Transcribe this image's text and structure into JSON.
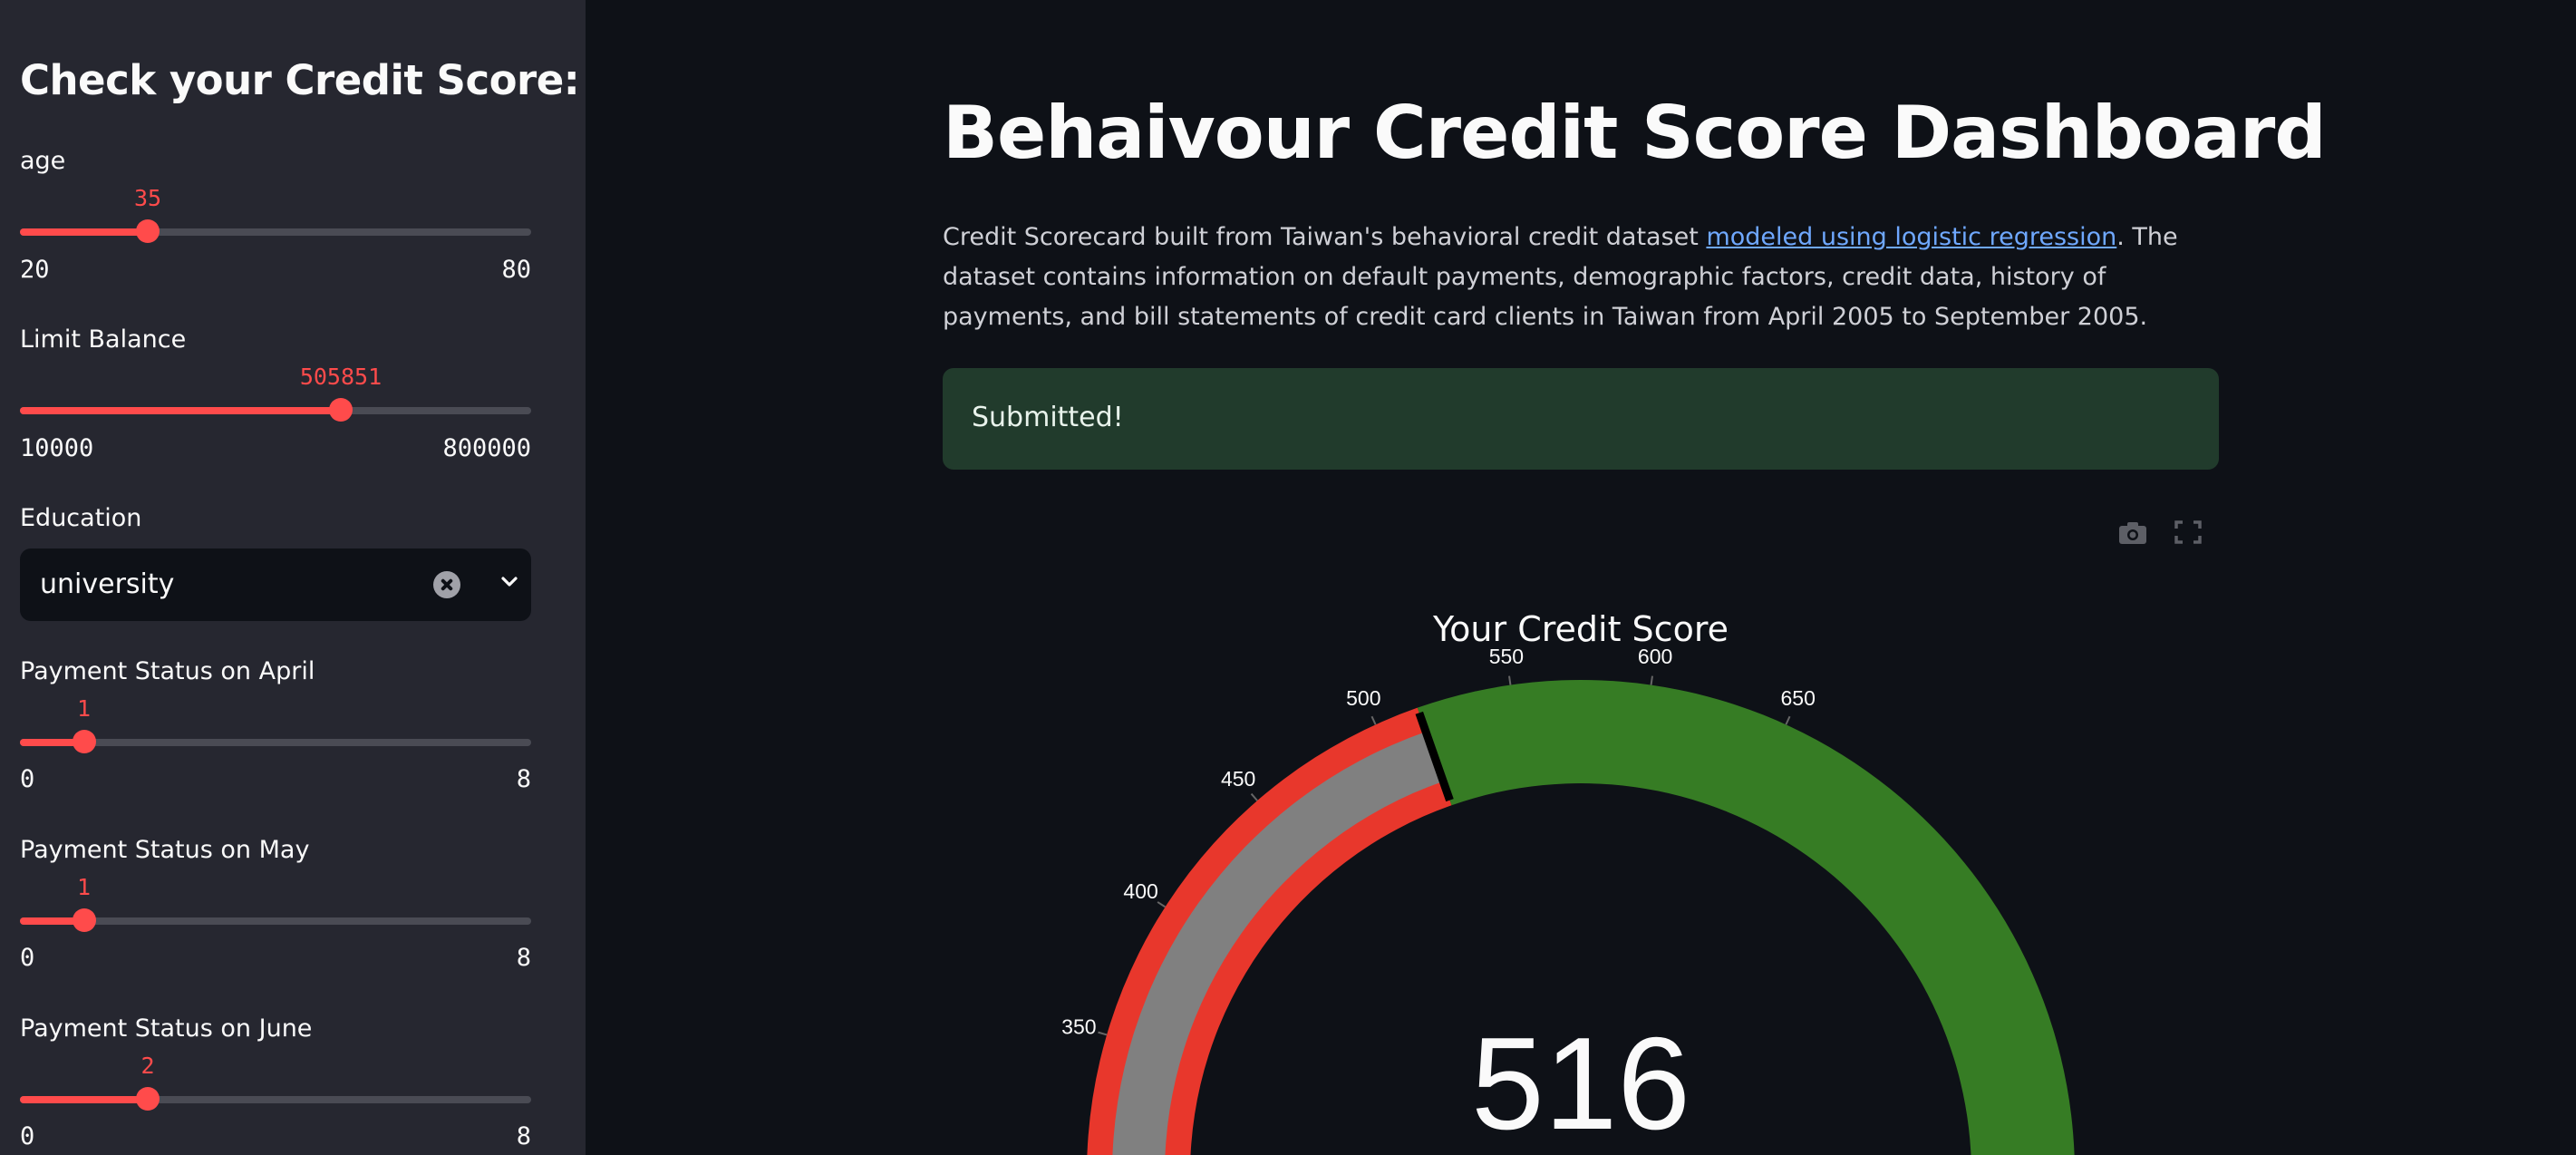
{
  "sidebar": {
    "title": "Check your Credit Score:",
    "age": {
      "label": "age",
      "value": 35,
      "min": 20,
      "max": 80
    },
    "limit_balance": {
      "label": "Limit Balance",
      "value": 505851,
      "min": 10000,
      "max": 800000
    },
    "education": {
      "label": "Education",
      "value": "university"
    },
    "pay_april": {
      "label": "Payment Status on April",
      "value": 1,
      "min": 0,
      "max": 8
    },
    "pay_may": {
      "label": "Payment Status on May",
      "value": 1,
      "min": 0,
      "max": 8
    },
    "pay_june": {
      "label": "Payment Status on June",
      "value": 2,
      "min": 0,
      "max": 8
    }
  },
  "main": {
    "title": "Behaivour Credit Score Dashboard",
    "description_pre": "Credit Scorecard built from Taiwan's behavioral credit dataset ",
    "description_link": "modeled using logistic regression",
    "description_post": ". The dataset contains information on default payments, demographic factors, credit data, history of payments, and bill statements of credit card clients in Taiwan from April 2005 to September 2005.",
    "alert": "Submitted!",
    "modebar": [
      "camera-icon",
      "fullscreen-icon"
    ]
  },
  "gauge": {
    "title": "Your Credit Score",
    "value": 516,
    "threshold": 516,
    "range": [
      300,
      850
    ],
    "ticks": [
      350,
      400,
      450,
      500,
      550,
      600,
      650
    ],
    "bands": [
      {
        "from": 300,
        "to": 516,
        "color": "#e8372c"
      },
      {
        "from": 516,
        "to": 850,
        "color": "#367c24"
      }
    ],
    "bar_color": "#808080",
    "threshold_color": "#000000"
  },
  "colors": {
    "accent": "#ff4b4b",
    "sidebar_bg": "#262730",
    "main_bg": "#0e1117",
    "alert_bg": "#213b2c",
    "link": "#6fa8ff"
  }
}
